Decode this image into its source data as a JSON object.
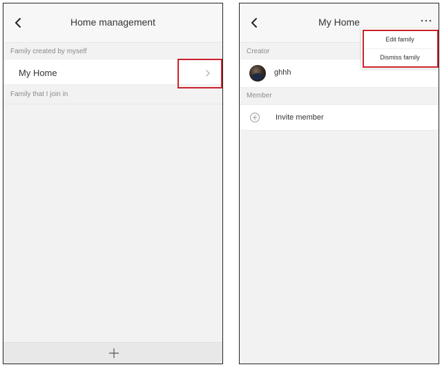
{
  "left_screen": {
    "header": {
      "title": "Home management"
    },
    "sections": {
      "created_label": "Family created by myself",
      "joined_label": "Family that I join in"
    },
    "families": [
      {
        "name": "My Home"
      }
    ]
  },
  "right_screen": {
    "header": {
      "title": "My Home"
    },
    "menu": {
      "items": [
        {
          "label": "Edit family"
        },
        {
          "label": "Dismiss family"
        }
      ]
    },
    "sections": {
      "creator_label": "Creator",
      "member_label": "Member"
    },
    "creator": {
      "name": "ghhh"
    },
    "invite": {
      "label": "Invite member"
    }
  },
  "colors": {
    "highlight": "#c9202a",
    "background": "#f2f2f2",
    "row": "#ffffff"
  },
  "icons": [
    "back-icon",
    "chevron-right-icon",
    "add-icon",
    "more-icon",
    "plus-circle-icon",
    "avatar"
  ]
}
